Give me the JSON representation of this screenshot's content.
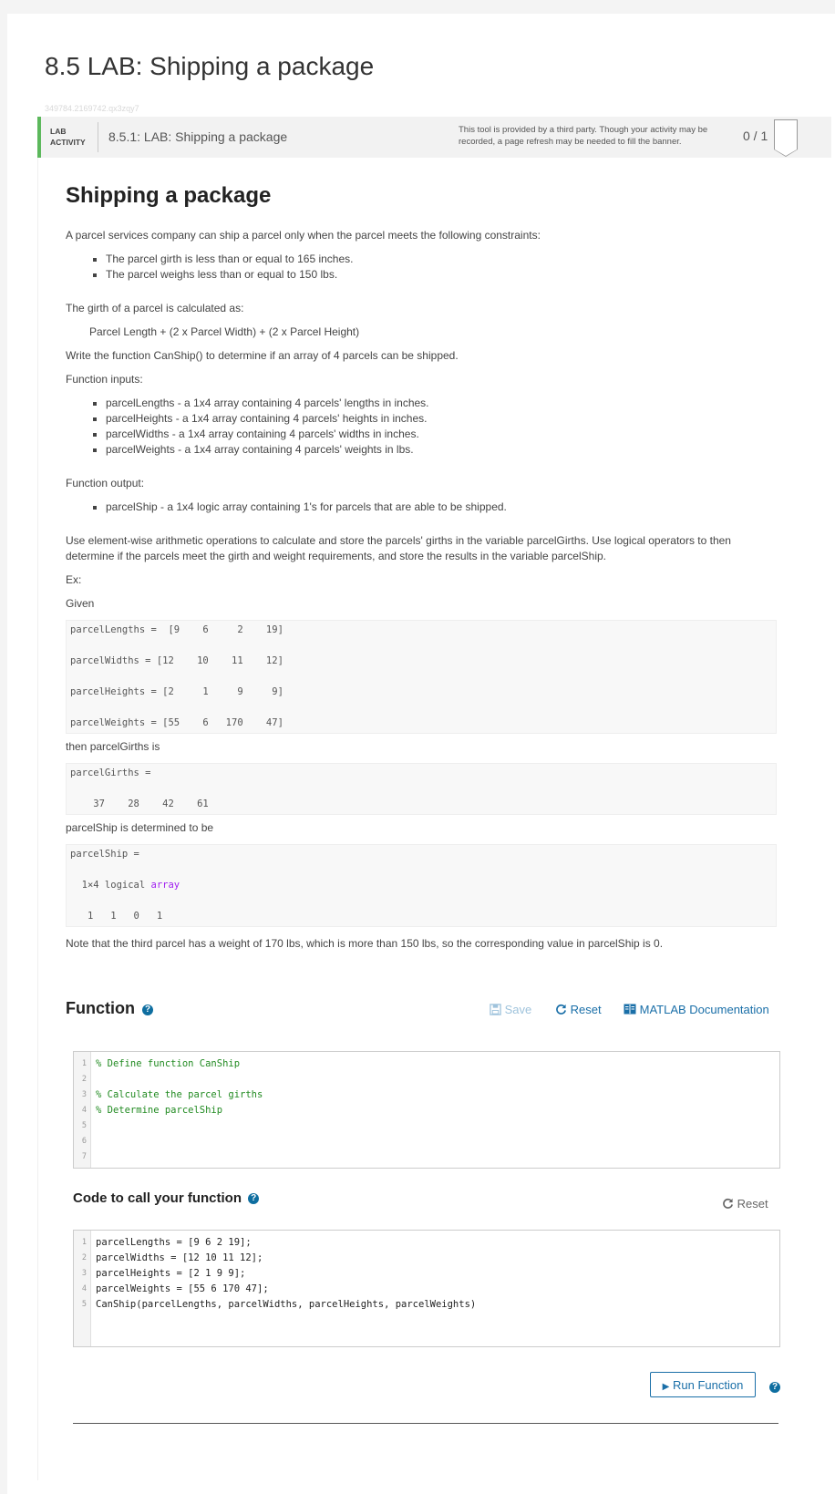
{
  "section": {
    "title": "8.5 LAB: Shipping a package",
    "id": "349784.2169742.qx3zqy7"
  },
  "banner": {
    "label_line1": "LAB",
    "label_line2": "ACTIVITY",
    "name": "8.5.1: LAB: Shipping a package",
    "note": "This tool is provided by a third party. Though your activity may be recorded, a page refresh may be needed to fill the banner.",
    "score": "0 / 1"
  },
  "problem": {
    "title": "Shipping a package",
    "intro": "A parcel services company can ship a parcel only when the parcel meets the following constraints:",
    "constraints": [
      "The parcel girth is less than or equal to 165 inches.",
      "The parcel weighs less than or equal to 150 lbs."
    ],
    "girth_intro": "The girth of a parcel is calculated as:",
    "girth_formula": "Parcel Length + (2 x Parcel Width) + (2 x Parcel Height)",
    "task": "Write the function CanShip() to determine if an array of 4 parcels can be shipped.",
    "inputs_label": "Function inputs:",
    "inputs": [
      "parcelLengths - a 1x4 array containing 4 parcels' lengths in inches.",
      "parcelHeights -  a 1x4 array containing 4 parcels' heights in inches.",
      "parcelWidths -  a 1x4 array containing 4 parcels' widths in inches.",
      "parcelWeights -  a 1x4 array containing 4 parcels' weights in lbs."
    ],
    "output_label": "Function output:",
    "outputs": [
      "parcelShip - a 1x4 logic array containing 1's for parcels that are able to be shipped."
    ],
    "instructions": "Use element-wise arithmetic operations to calculate and store the parcels' girths in the variable parcelGirths. Use logical operators to then determine if the parcels meet the girth and weight requirements, and store the results in the variable parcelShip.",
    "ex_label": "Ex:",
    "given_label": "Given",
    "given_code": [
      "parcelLengths =  [9    6     2    19]",
      "parcelWidths = [12    10    11    12]",
      "parcelHeights = [2     1     9     9]",
      "parcelWeights = [55    6   170    47]"
    ],
    "girths_label": "then parcelGirths is",
    "girths_code": [
      "parcelGirths =",
      "    37    28    42    61"
    ],
    "ship_label": "parcelShip is determined to be",
    "ship_code_line1": "parcelShip =",
    "ship_code_line2_a": "  1×4 logical ",
    "ship_code_line2_b": "array",
    "ship_code_line3": "   1   1   0   1",
    "note": "Note that the third parcel has a weight of 170 lbs, which is more than 150 lbs, so the corresponding value in parcelShip is 0."
  },
  "function_section": {
    "title": "Function",
    "save_label": "Save",
    "reset_label": "Reset",
    "docs_label": "MATLAB Documentation",
    "lines": [
      {
        "n": "1",
        "text": "% Define function CanShip"
      },
      {
        "n": "2",
        "text": ""
      },
      {
        "n": "3",
        "text": "% Calculate the parcel girths"
      },
      {
        "n": "4",
        "text": "% Determine parcelShip"
      },
      {
        "n": "5",
        "text": ""
      },
      {
        "n": "6",
        "text": ""
      },
      {
        "n": "7",
        "text": ""
      }
    ]
  },
  "call_section": {
    "title": "Code to call your function",
    "reset_label": "Reset",
    "lines": [
      {
        "n": "1",
        "text": "parcelLengths = [9 6 2 19];"
      },
      {
        "n": "2",
        "text": "parcelWidths = [12 10 11 12];"
      },
      {
        "n": "3",
        "text": "parcelHeights = [2 1 9 9];"
      },
      {
        "n": "4",
        "text": "parcelWeights = [55 6 170 47];"
      },
      {
        "n": "5",
        "text": "CanShip(parcelLengths, parcelWidths, parcelHeights, parcelWeights)"
      }
    ]
  },
  "run_label": "Run Function",
  "help_glyph": "?",
  "colors": {
    "accent": "#1a6fa8",
    "banner_bar": "#5cb85c",
    "comment": "#228b22",
    "keyword": "#a020f0"
  }
}
